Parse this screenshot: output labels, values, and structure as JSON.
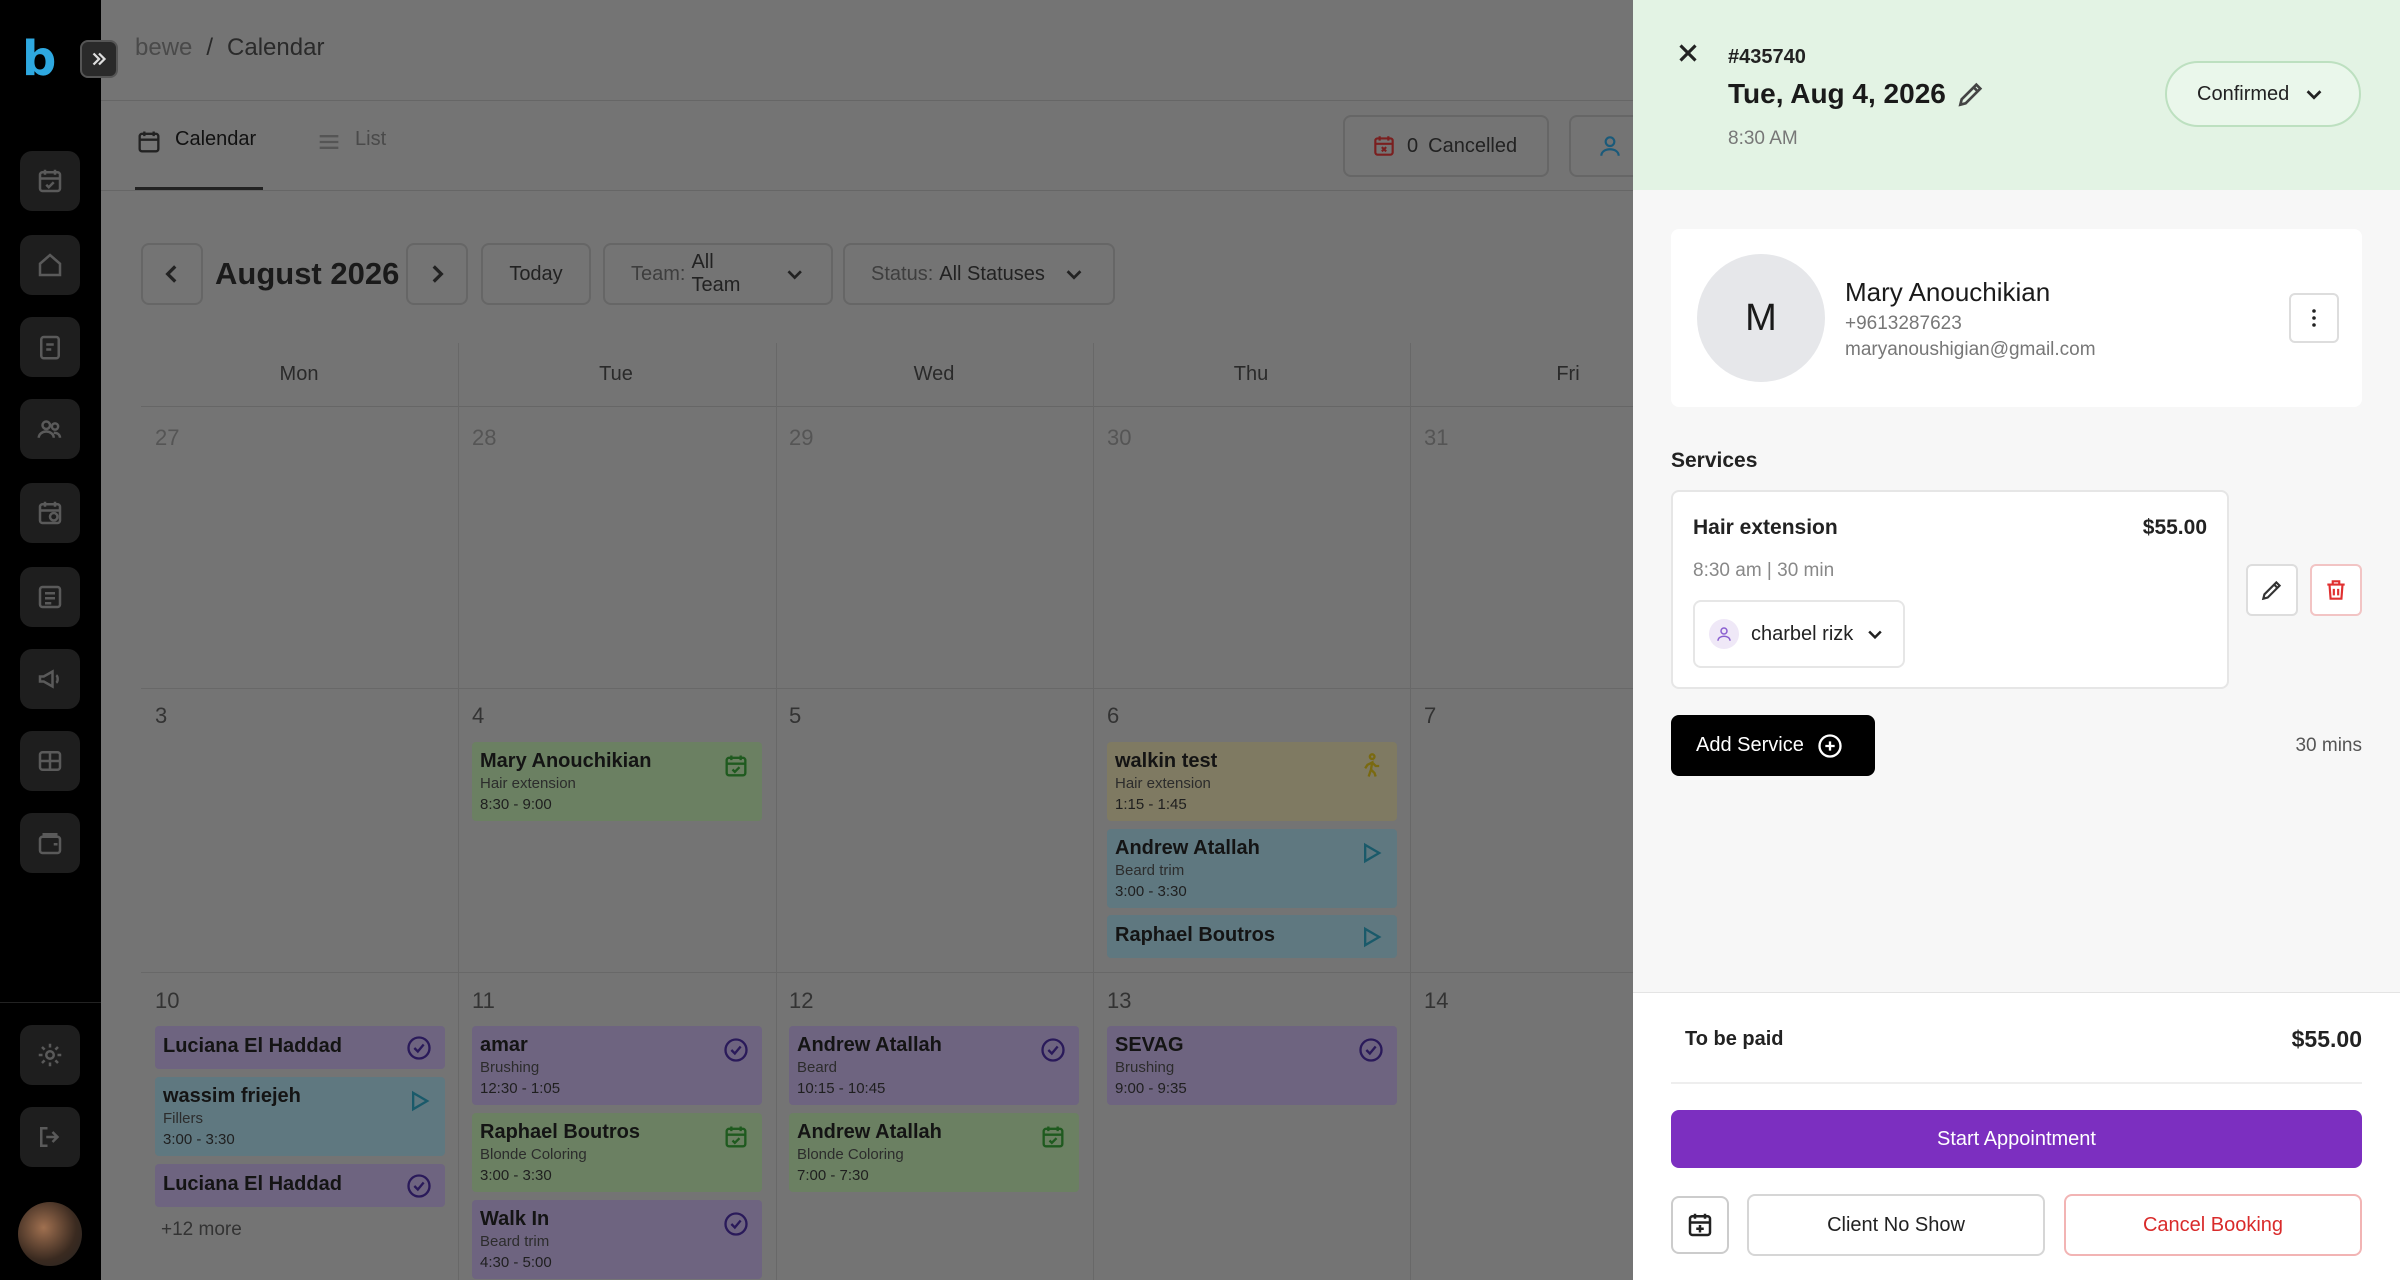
{
  "breadcrumb": {
    "root": "bewe",
    "separator": "/",
    "current": "Calendar"
  },
  "view_tabs": {
    "calendar": "Calendar",
    "list": "List"
  },
  "toolbar": {
    "cancelled_count": "0",
    "cancelled_label": "Cancelled",
    "month": "August 2026",
    "today": "Today",
    "team_label": "Team:",
    "team_value": "All Team",
    "status_label": "Status:",
    "status_value": "All Statuses"
  },
  "calendar": {
    "day_names": [
      "Mon",
      "Tue",
      "Wed",
      "Thu",
      "Fri"
    ],
    "weeks": [
      [
        "27",
        "28",
        "29",
        "30",
        "31"
      ],
      [
        "3",
        "4",
        "5",
        "6",
        "7"
      ],
      [
        "10",
        "11",
        "12",
        "13",
        "14"
      ]
    ],
    "events": [
      {
        "name": "Mary Anouchikian",
        "service": "Hair extension",
        "time": "8:30 - 9:00"
      },
      {
        "name": "walkin test",
        "service": "Hair extension",
        "time": "1:15 - 1:45"
      },
      {
        "name": "Andrew Atallah",
        "service": "Beard trim",
        "time": "3:00 - 3:30"
      },
      {
        "name": "Raphael Boutros"
      },
      {
        "name": "Luciana El Haddad"
      },
      {
        "name": "wassim friejeh",
        "service": "Fillers",
        "time": "3:00 - 3:30"
      },
      {
        "name": "Luciana El Haddad"
      },
      {
        "name": "amar",
        "service": "Brushing",
        "time": "12:30 - 1:05"
      },
      {
        "name": "Raphael Boutros",
        "service": "Blonde Coloring",
        "time": "3:00 - 3:30"
      },
      {
        "name": "Walk In",
        "service": "Beard trim",
        "time": "4:30 - 5:00"
      },
      {
        "name": "Andrew Atallah",
        "service": "Beard",
        "time": "10:15 - 10:45"
      },
      {
        "name": "Andrew Atallah",
        "service": "Blonde Coloring",
        "time": "7:00 - 7:30"
      },
      {
        "name": "SEVAG",
        "service": "Brushing",
        "time": "9:00 - 9:35"
      }
    ],
    "more_link": "+12 more"
  },
  "panel": {
    "booking_id": "#435740",
    "date": "Tue, Aug 4, 2026",
    "time": "8:30 AM",
    "status": "Confirmed",
    "client": {
      "initial": "M",
      "name": "Mary Anouchikian",
      "phone": "+9613287623",
      "email": "maryanoushigian@gmail.com"
    },
    "services_title": "Services",
    "service": {
      "name": "Hair extension",
      "price": "$55.00",
      "time_duration": "8:30 am | 30 min",
      "staff": "charbel rizk"
    },
    "add_service": "Add Service",
    "total_duration": "30 mins",
    "to_be_paid_label": "To be paid",
    "to_be_paid_amount": "$55.00",
    "start_appointment": "Start Appointment",
    "client_no_show": "Client No Show",
    "cancel_booking": "Cancel Booking"
  },
  "colors": {
    "accent_purple": "#7c2fc0",
    "header_green": "#e3f3e4",
    "danger_red": "#d92b2b",
    "logo_blue": "#2ea8e0"
  }
}
